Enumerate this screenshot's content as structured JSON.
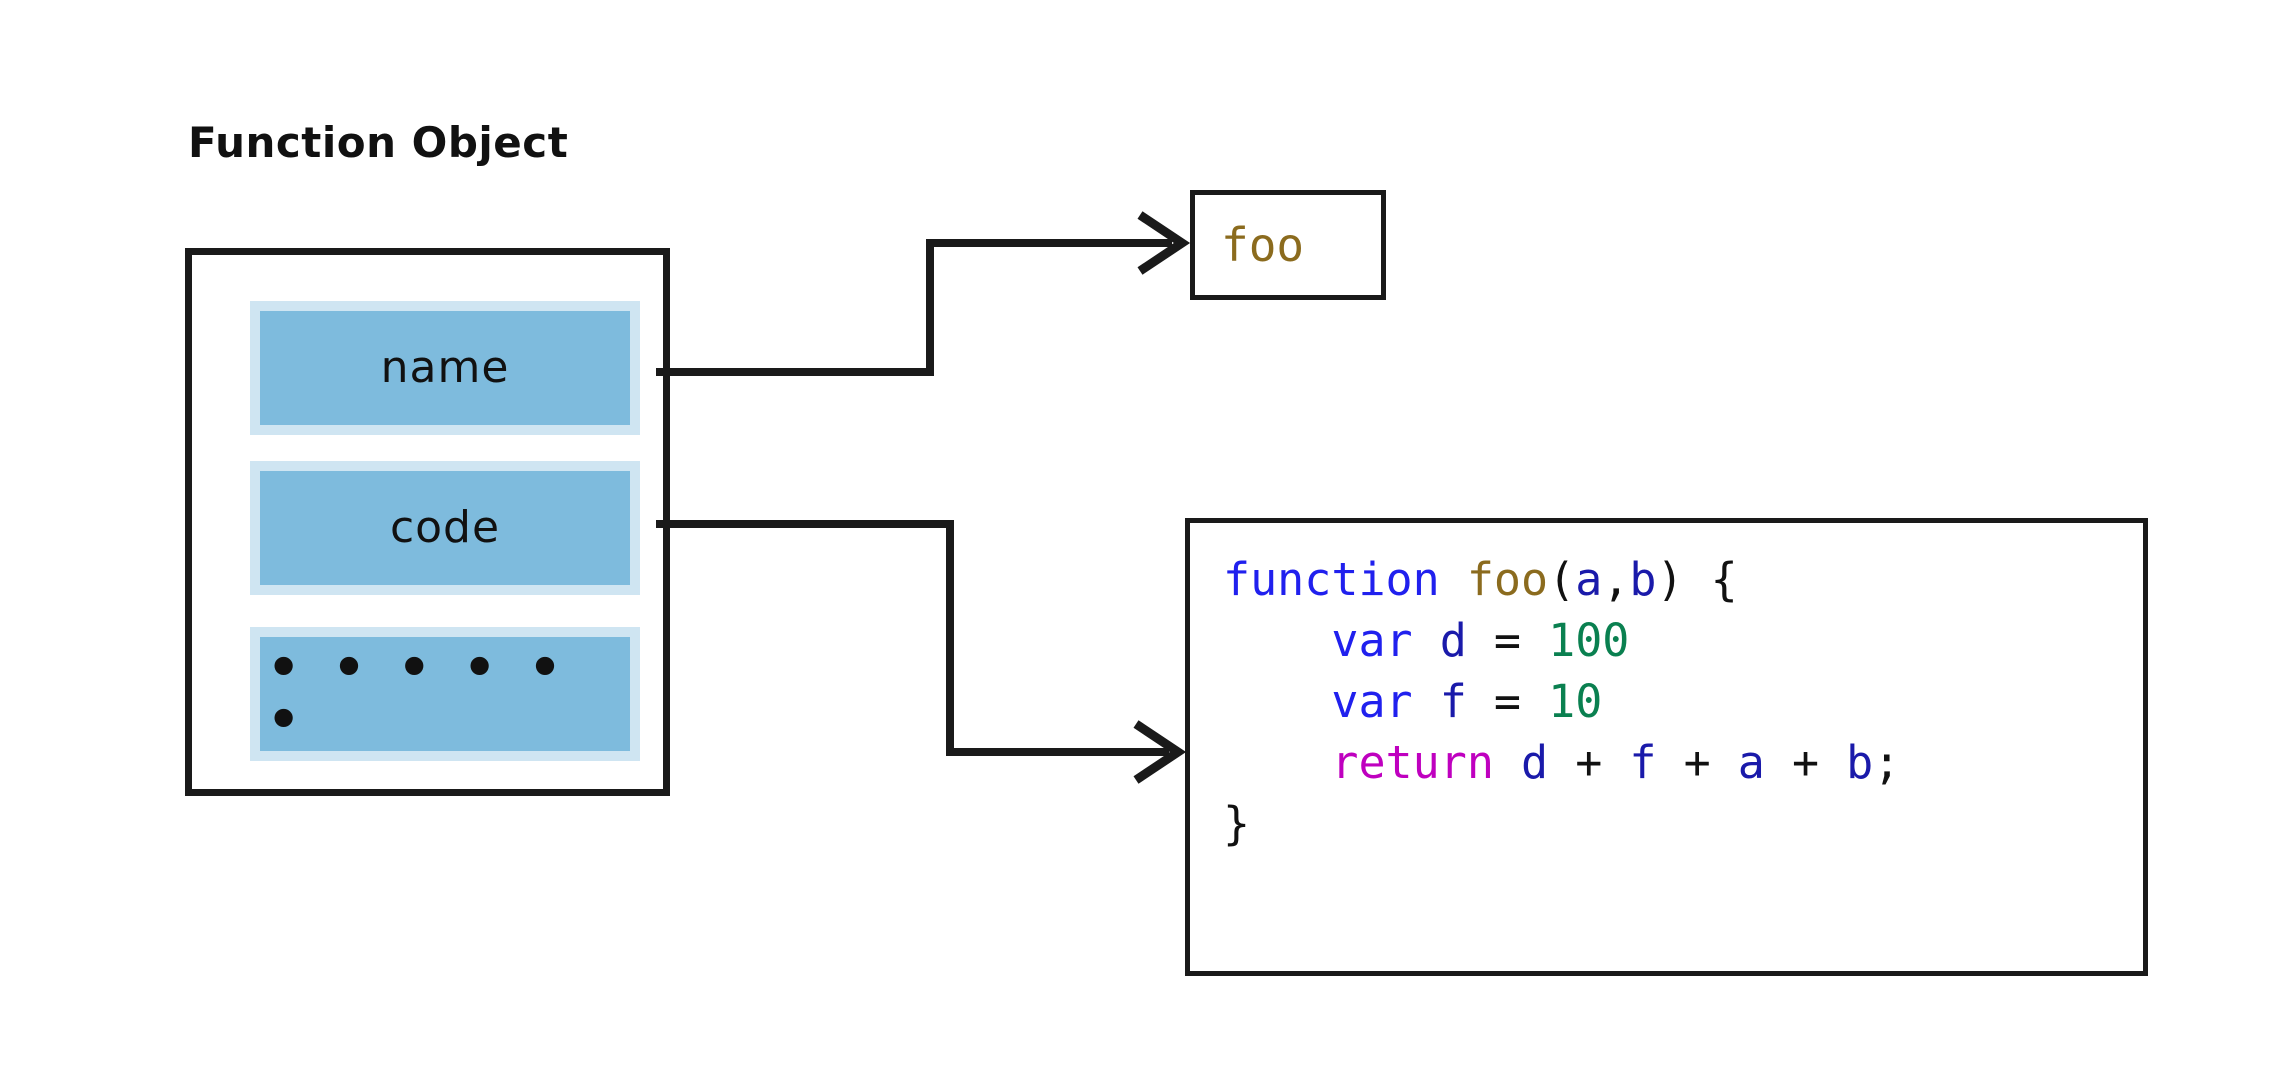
{
  "title": "Function Object",
  "function_object": {
    "slots": [
      {
        "label": "name",
        "kind": "property"
      },
      {
        "label": "code",
        "kind": "property"
      },
      {
        "label": "• • • • • •",
        "kind": "ellipsis"
      }
    ]
  },
  "name_value": {
    "text": "foo"
  },
  "code_value": {
    "lines": [
      {
        "tokens": [
          {
            "text": "function",
            "type": "keyword"
          },
          {
            "text": " ",
            "type": "plain"
          },
          {
            "text": "foo",
            "type": "function-name"
          },
          {
            "text": "(",
            "type": "punct"
          },
          {
            "text": "a",
            "type": "identifier"
          },
          {
            "text": ",",
            "type": "punct"
          },
          {
            "text": "b",
            "type": "identifier"
          },
          {
            "text": ") {",
            "type": "punct"
          }
        ]
      },
      {
        "tokens": [
          {
            "text": "    ",
            "type": "plain"
          },
          {
            "text": "var",
            "type": "keyword"
          },
          {
            "text": " ",
            "type": "plain"
          },
          {
            "text": "d",
            "type": "identifier"
          },
          {
            "text": " = ",
            "type": "punct"
          },
          {
            "text": "100",
            "type": "number"
          }
        ]
      },
      {
        "tokens": [
          {
            "text": "    ",
            "type": "plain"
          },
          {
            "text": "var",
            "type": "keyword"
          },
          {
            "text": " ",
            "type": "plain"
          },
          {
            "text": "f",
            "type": "identifier"
          },
          {
            "text": " = ",
            "type": "punct"
          },
          {
            "text": "10",
            "type": "number"
          }
        ]
      },
      {
        "tokens": [
          {
            "text": "    ",
            "type": "plain"
          },
          {
            "text": "return",
            "type": "return-keyword"
          },
          {
            "text": " ",
            "type": "plain"
          },
          {
            "text": "d",
            "type": "identifier"
          },
          {
            "text": " + ",
            "type": "punct"
          },
          {
            "text": "f",
            "type": "identifier"
          },
          {
            "text": " + ",
            "type": "punct"
          },
          {
            "text": "a",
            "type": "identifier"
          },
          {
            "text": " + ",
            "type": "punct"
          },
          {
            "text": "b",
            "type": "identifier"
          },
          {
            "text": ";",
            "type": "punct"
          }
        ]
      },
      {
        "tokens": [
          {
            "text": "}",
            "type": "punct"
          }
        ]
      }
    ],
    "plain_text": "function foo(a,b) {\n    var d = 100\n    var f = 10\n    return d + f + a + b;\n}"
  },
  "connectors": [
    {
      "from": "name",
      "to": "foo-box",
      "style": "elbow-up-arrow"
    },
    {
      "from": "code",
      "to": "code-box",
      "style": "elbow-down-arrow"
    }
  ],
  "colors": {
    "slot_fill": "#7ebbdd",
    "slot_halo": "#cfe5f2",
    "stroke": "#1a1a1a",
    "keyword": "#2020ee",
    "function_name": "#8b6b1e",
    "identifier": "#1a1aaa",
    "number": "#0a8050",
    "return_keyword": "#bf00bf",
    "background": "#ffffff"
  }
}
